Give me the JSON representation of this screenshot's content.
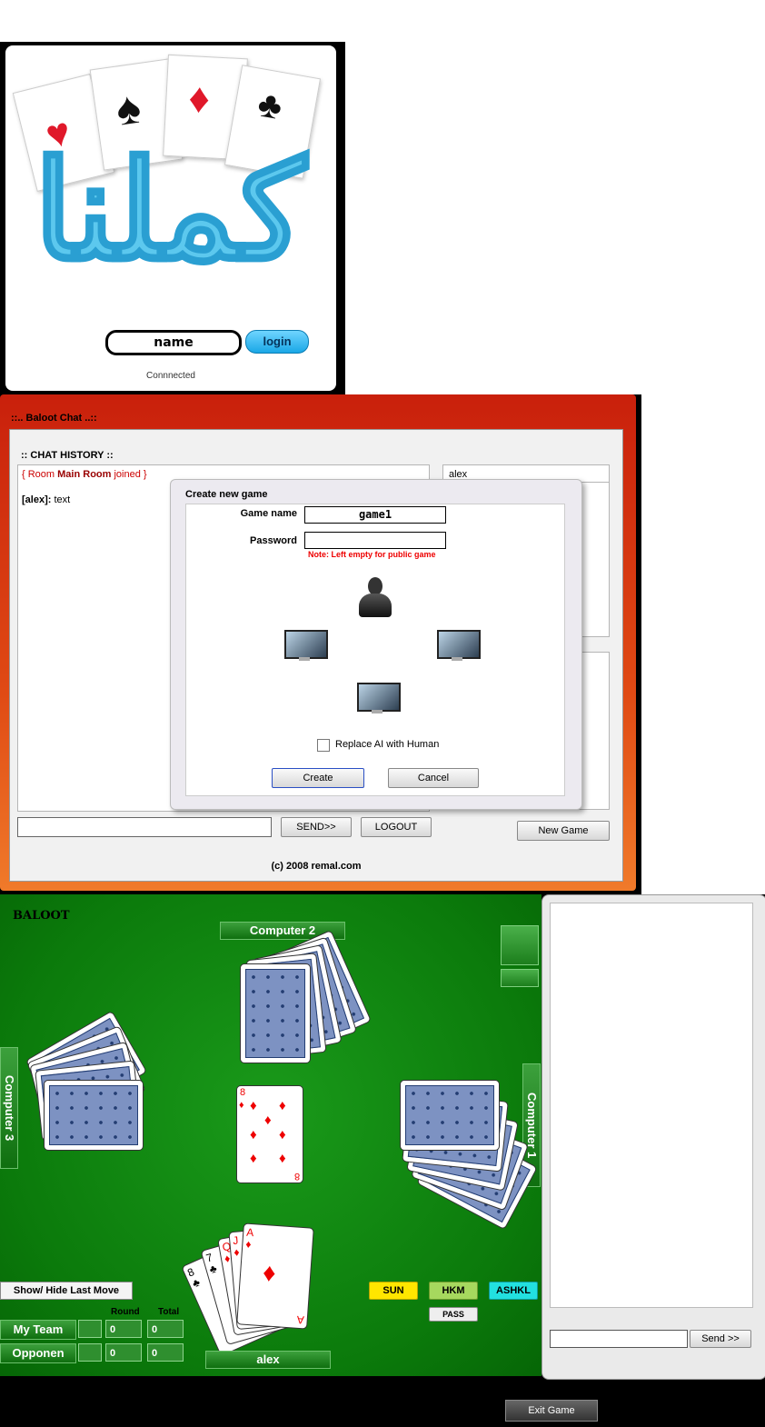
{
  "login": {
    "logo_text": "كملنا",
    "name_value": "name",
    "login_button": "login",
    "status": "Connnected"
  },
  "chat": {
    "window_title": "::.. Baloot Chat ..::",
    "history_label": ":: CHAT HISTORY ::",
    "system_prefix": "{ Room ",
    "system_room": "Main Room",
    "system_suffix": " joined }",
    "user_tag": "[alex]:",
    "user_msg": " text",
    "users": [
      "alex"
    ],
    "send_button": "SEND>>",
    "logout_button": "LOGOUT",
    "new_game_button": "New Game",
    "copyright": "(c) 2008 remal.com"
  },
  "dialog": {
    "title": "Create new game",
    "game_name_label": "Game name",
    "game_name_value": "game1",
    "password_label": "Password",
    "note": "Note: Left empty for public game",
    "replace_label": "Replace AI with Human",
    "create_button": "Create",
    "cancel_button": "Cancel"
  },
  "game": {
    "title": "BALOOT",
    "players": {
      "top": "Computer 2",
      "left": "Computer 3",
      "right": "Computer 1",
      "bottom": "alex"
    },
    "center_card": {
      "rank": "8",
      "suit": "♦"
    },
    "hand": [
      {
        "rank": "8",
        "suit": "♣"
      },
      {
        "rank": "7",
        "suit": "♣"
      },
      {
        "rank": "Q",
        "suit": "♦"
      },
      {
        "rank": "J",
        "suit": "♦"
      },
      {
        "rank": "A",
        "suit": "♦"
      }
    ],
    "show_hide_button": "Show/ Hide Last Move",
    "bids": {
      "sun": "SUN",
      "hkm": "HKM",
      "ashkl": "ASHKL",
      "pass": "PASS"
    },
    "score": {
      "round_label": "Round",
      "total_label": "Total",
      "rows": [
        {
          "team": "My Team",
          "round": "0",
          "total": "0"
        },
        {
          "team": "Opponen",
          "round": "0",
          "total": "0"
        }
      ]
    },
    "side_send": "Send >>",
    "exit_button": "Exit Game"
  },
  "colors": {
    "table_green": "#0b7a0b",
    "chat_red": "#c9200c",
    "sun_yellow": "#ffe600",
    "hkm_green": "#a6d85e",
    "ashkl_cyan": "#22e0e0",
    "logo_blue": "#5cc8ee"
  }
}
